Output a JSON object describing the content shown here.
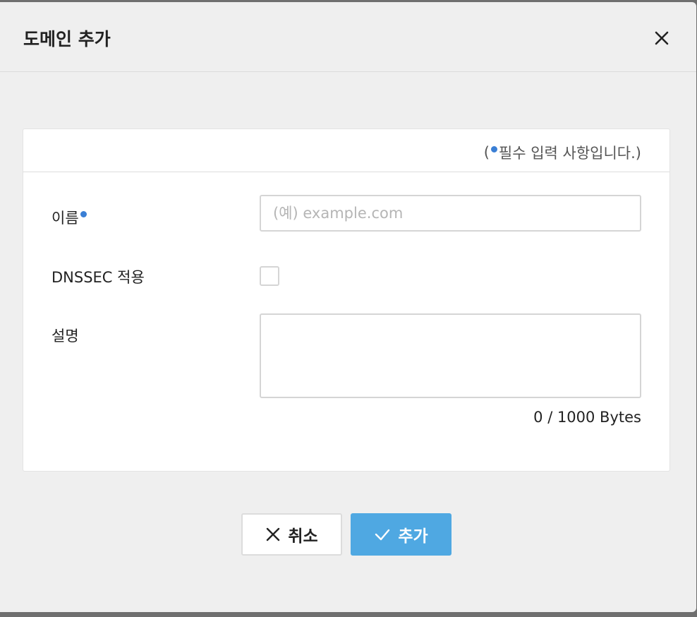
{
  "dialog": {
    "title": "도메인 추가"
  },
  "form": {
    "required_note_open": "(",
    "required_note_text": "필수 입력 사항입니다.)",
    "name_label": "이름",
    "name_placeholder": "(예) example.com",
    "name_value": "",
    "dnssec_label": "DNSSEC 적용",
    "dnssec_checked": false,
    "description_label": "설명",
    "description_value": "",
    "bytes_counter": "0 / 1000 Bytes"
  },
  "buttons": {
    "cancel_label": "취소",
    "add_label": "추가"
  },
  "colors": {
    "required_dot": "#3a7fd5",
    "primary_button": "#4fa8e2"
  },
  "icons": {
    "close": "close-icon",
    "cancel": "x-icon",
    "add": "check-icon"
  }
}
